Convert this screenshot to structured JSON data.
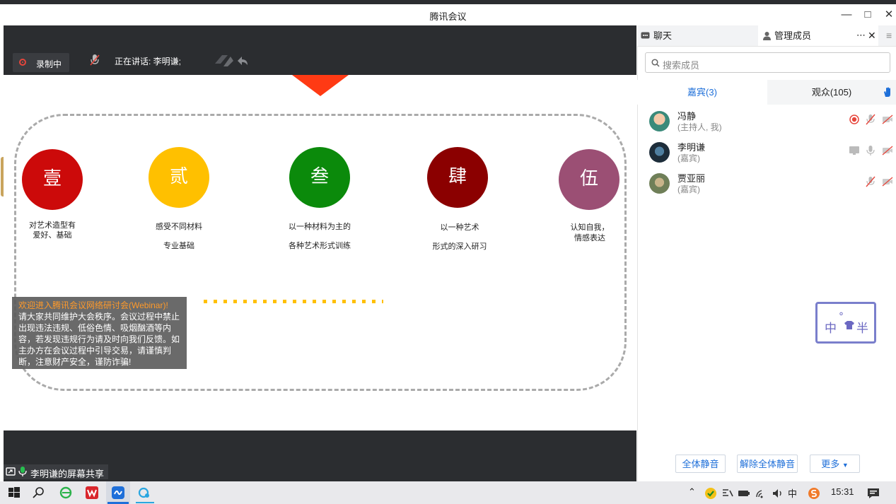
{
  "window": {
    "title": "腾讯会议"
  },
  "stage": {
    "recording_label": "录制中",
    "speaking_label": "正在讲话: 李明谦;",
    "share_label": "李明谦的屏幕共享"
  },
  "slide": {
    "items": [
      {
        "glyph": "壹",
        "color": "#cc0a0a",
        "caption_lines": [
          "对艺术造型有",
          "爱好、基础"
        ]
      },
      {
        "glyph": "贰",
        "color": "#ffc000",
        "caption_lines": [
          "感受不同材料",
          "专业基础"
        ]
      },
      {
        "glyph": "叁",
        "color": "#0b8a0b",
        "caption_lines": [
          "以一种材料为主的",
          "各种艺术形式训练"
        ]
      },
      {
        "glyph": "肆",
        "color": "#8b0000",
        "caption_lines": [
          "以一种艺术",
          "形式的深入研习"
        ]
      },
      {
        "glyph": "伍",
        "color": "#9b4f74",
        "caption_lines": [
          "认知自我，",
          "情感表达"
        ]
      }
    ]
  },
  "notice": {
    "highlight": "欢迎进入腾讯会议网络研讨会(Webinar)!",
    "body": "请大家共同维护大会秩序。会议过程中禁止出现违法违规、低俗色情、吸烟酗酒等内容，若发现违规行为请及时向我们反馈。如主办方在会议过程中引导交易，请谨慎判断，注意财产安全，谨防诈骗!"
  },
  "panel": {
    "tabs": {
      "chat": "聊天",
      "members": "管理成员"
    },
    "search_placeholder": "搜索成员",
    "subtabs": {
      "guests": "嘉宾(3)",
      "audience": "观众(105)"
    },
    "members": [
      {
        "name": "冯静",
        "role": "(主持人, 我)"
      },
      {
        "name": "李明谦",
        "role": "(嘉宾)"
      },
      {
        "name": "贾亚丽",
        "role": "(嘉宾)"
      }
    ],
    "buttons": {
      "mute_all": "全体静音",
      "unmute_all": "解除全体静音",
      "more": "更多"
    },
    "sticker": {
      "left": "中",
      "mid": "°",
      "right": "半"
    }
  },
  "taskbar": {
    "time": "15:31",
    "ime": "中"
  },
  "colors": {
    "accent": "#1e6fd9",
    "stage_bg": "#2b2d30",
    "record_red": "#e6463c"
  }
}
